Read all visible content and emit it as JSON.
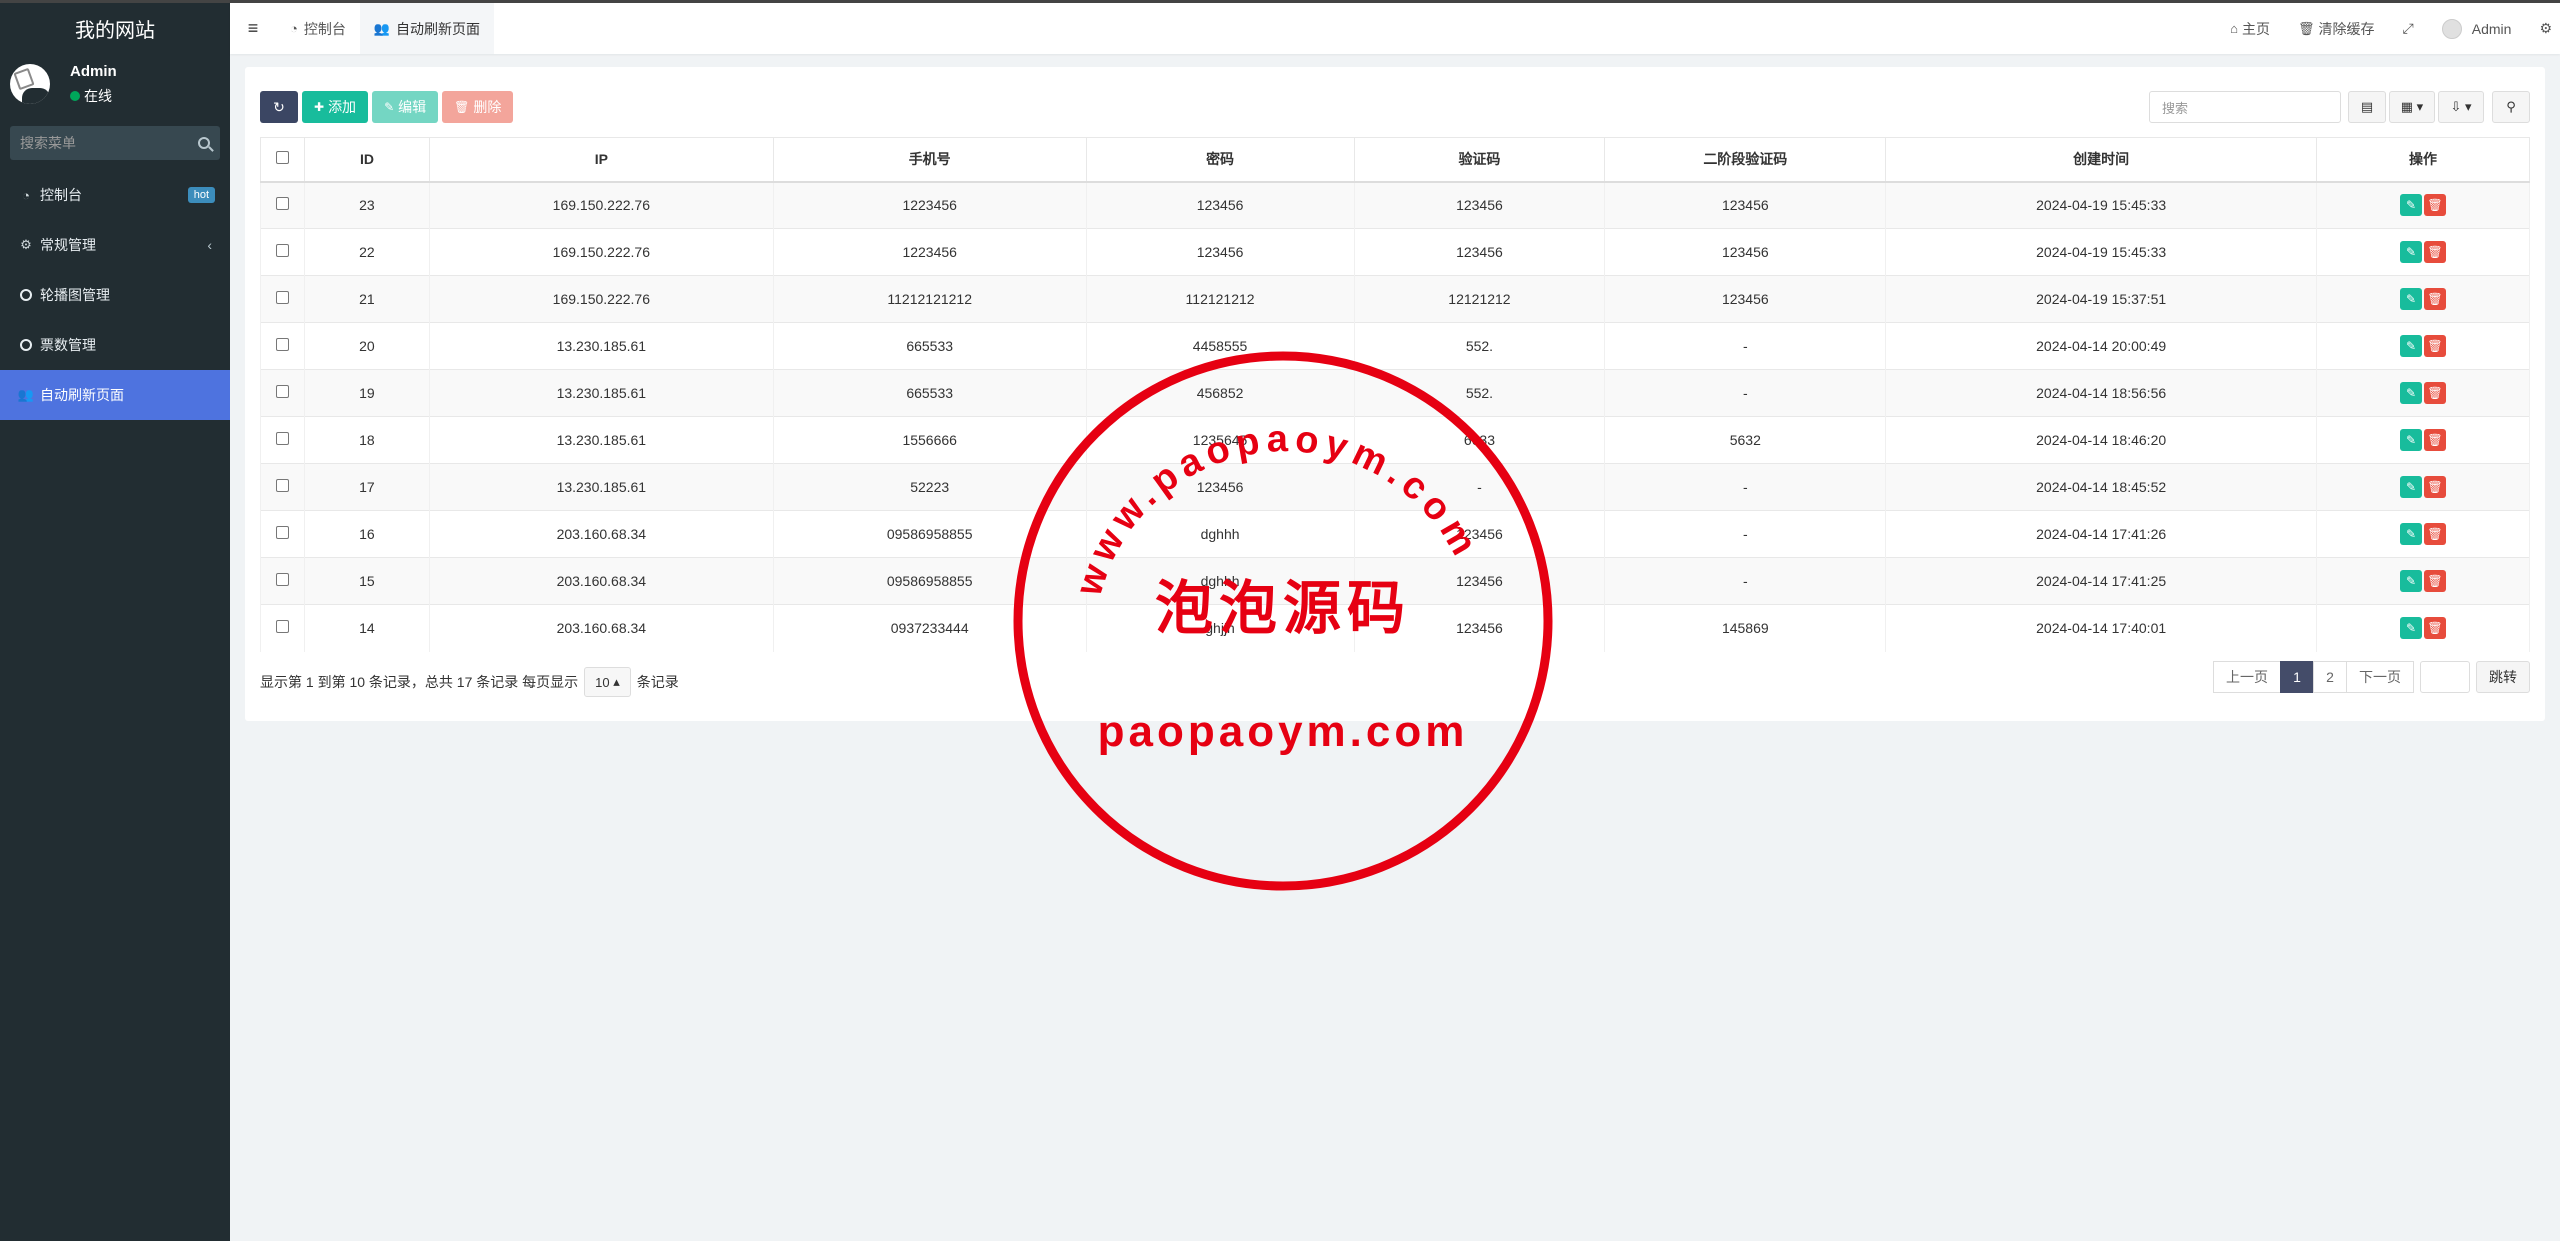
{
  "app": {
    "title": "我的网站"
  },
  "user": {
    "name": "Admin",
    "status": "在线"
  },
  "sidebar": {
    "search_placeholder": "搜索菜单",
    "items": [
      {
        "label": "控制台",
        "icon": "dashboard-icon",
        "badge": "hot"
      },
      {
        "label": "常规管理",
        "icon": "cogs-icon",
        "chevron": "‹"
      },
      {
        "label": "轮播图管理",
        "icon": "circle-icon"
      },
      {
        "label": "票数管理",
        "icon": "circle-icon"
      },
      {
        "label": "自动刷新页面",
        "icon": "users-icon",
        "active": true
      }
    ]
  },
  "topbar": {
    "tabs": [
      {
        "label": "控制台",
        "icon": "dashboard-icon"
      },
      {
        "label": "自动刷新页面",
        "icon": "users-icon",
        "active": true
      }
    ],
    "home_label": "主页",
    "clear_cache_label": "清除缓存",
    "user_label": "Admin"
  },
  "toolbar": {
    "add_label": "添加",
    "edit_label": "编辑",
    "delete_label": "删除",
    "search_placeholder": "搜索"
  },
  "table": {
    "headers": [
      "ID",
      "IP",
      "手机号",
      "密码",
      "验证码",
      "二阶段验证码",
      "创建时间",
      "操作"
    ],
    "rows": [
      [
        "23",
        "169.150.222.76",
        "1223456",
        "123456",
        "123456",
        "123456",
        "2024-04-19 15:45:33"
      ],
      [
        "22",
        "169.150.222.76",
        "1223456",
        "123456",
        "123456",
        "123456",
        "2024-04-19 15:45:33"
      ],
      [
        "21",
        "169.150.222.76",
        "11212121212",
        "112121212",
        "12121212",
        "123456",
        "2024-04-19 15:37:51"
      ],
      [
        "20",
        "13.230.185.61",
        "665533",
        "4458555",
        "552.",
        "-",
        "2024-04-14 20:00:49"
      ],
      [
        "19",
        "13.230.185.61",
        "665533",
        "456852",
        "552.",
        "-",
        "2024-04-14 18:56:56"
      ],
      [
        "18",
        "13.230.185.61",
        "1556666",
        "1235645",
        "6633",
        "5632",
        "2024-04-14 18:46:20"
      ],
      [
        "17",
        "13.230.185.61",
        "52223",
        "123456",
        "-",
        "-",
        "2024-04-14 18:45:52"
      ],
      [
        "16",
        "203.160.68.34",
        "09586958855",
        "dghhh",
        "123456",
        "-",
        "2024-04-14 17:41:26"
      ],
      [
        "15",
        "203.160.68.34",
        "09586958855",
        "dghhh",
        "123456",
        "-",
        "2024-04-14 17:41:25"
      ],
      [
        "14",
        "203.160.68.34",
        "0937233444",
        "ghjjh",
        "123456",
        "145869",
        "2024-04-14 17:40:01"
      ]
    ]
  },
  "pager": {
    "info_prefix": "显示第 1 到第 10 条记录，总共 17 条记录 每页显示",
    "page_size": "10",
    "info_suffix": "条记录",
    "prev": "上一页",
    "pages": [
      "1",
      "2"
    ],
    "current": "1",
    "next": "下一页",
    "go": "跳转"
  },
  "watermark": {
    "arc_text": "www.paopaoym.com",
    "center_text": "泡泡源码",
    "bottom_text": "paopaoym.com",
    "color": "#e60012"
  },
  "colors": {
    "sidebar_bg": "#222d32",
    "active_menu": "#4e73df",
    "add_btn": "#18bc9c",
    "delete_btn": "#e74c3c",
    "page_active": "#444c69"
  }
}
